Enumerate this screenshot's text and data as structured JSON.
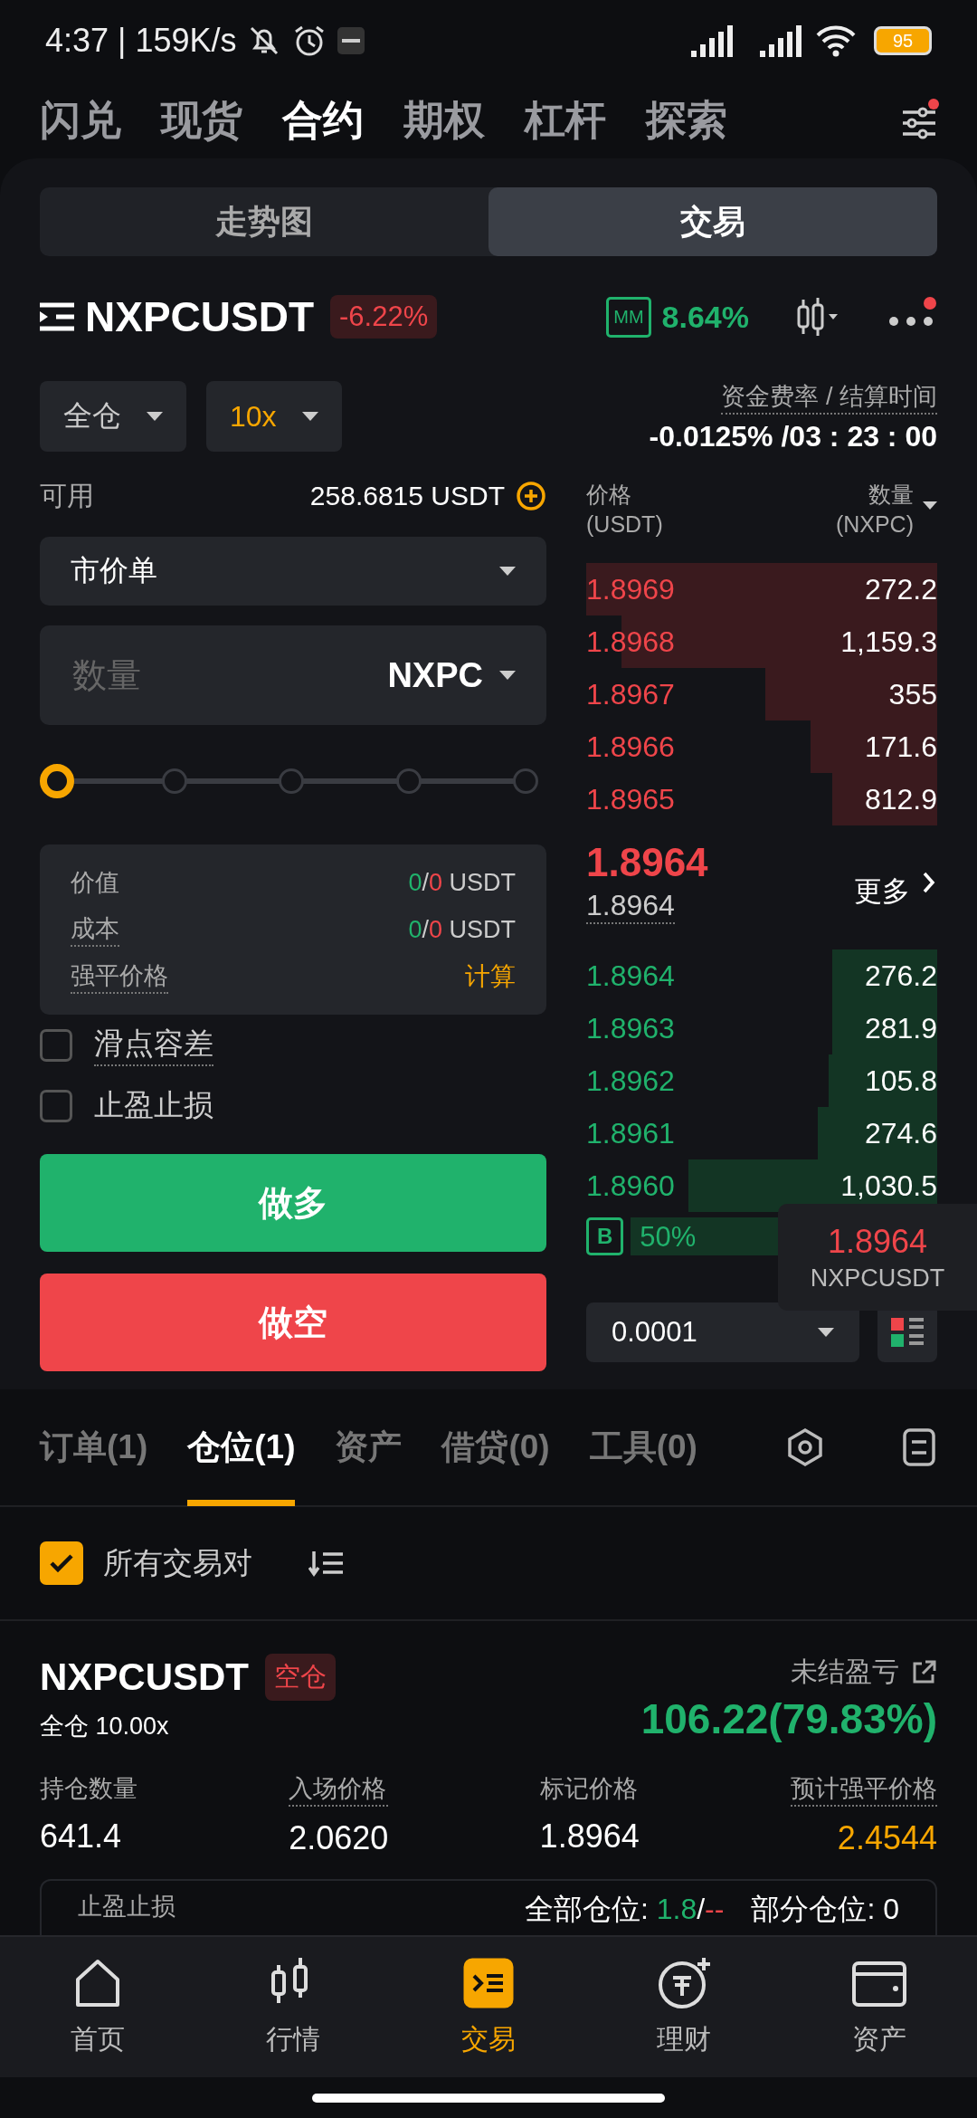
{
  "status_bar": {
    "text": "4:37 | 159K/s",
    "battery": "95"
  },
  "top_tabs": [
    {
      "label": "闪兑",
      "selected": false
    },
    {
      "label": "现货",
      "selected": false
    },
    {
      "label": "合约",
      "selected": true
    },
    {
      "label": "期权",
      "selected": false
    },
    {
      "label": "杠杆",
      "selected": false
    },
    {
      "label": "探索",
      "selected": false
    }
  ],
  "view_toggle": [
    {
      "label": "走势图",
      "selected": false
    },
    {
      "label": "交易",
      "selected": true
    }
  ],
  "symbol": {
    "name": "NXPCUSDT",
    "change": "-6.22%",
    "mm_label": "MM",
    "mm_rate": "8.64%"
  },
  "margin_mode": "全仓",
  "leverage": "10x",
  "funding": {
    "label": "资金费率 / 结算时间",
    "value": "-0.0125% /03 : 23 : 00"
  },
  "available": {
    "label": "可用",
    "value": "258.6815 USDT"
  },
  "order_type": "市价单",
  "quantity": {
    "placeholder": "数量",
    "unit": "NXPC"
  },
  "slider": {
    "level": 0
  },
  "summary": [
    {
      "kind": "values",
      "label": "价值",
      "underlined": false,
      "buy": "0",
      "sep": "/",
      "sell": "0",
      "unit": "USDT"
    },
    {
      "kind": "values",
      "label": "成本",
      "underlined": true,
      "buy": "0",
      "sep": "/",
      "sell": "0",
      "unit": "USDT"
    },
    {
      "kind": "action",
      "label": "强平价格",
      "underlined": true,
      "action": "计算"
    }
  ],
  "options": [
    {
      "label": "滑点容差",
      "underlined": true,
      "checked": false
    },
    {
      "label": "止盈止损",
      "underlined": false,
      "checked": false
    }
  ],
  "buttons": {
    "long": "做多",
    "short": "做空"
  },
  "orderbook": {
    "price_header": "价格",
    "price_unit": "(USDT)",
    "qty_header": "数量",
    "qty_unit": "(NXPC)",
    "asks": [
      {
        "price": "1.8969",
        "qty": "272.2"
      },
      {
        "price": "1.8968",
        "qty": "1,159.3"
      },
      {
        "price": "1.8967",
        "qty": "355"
      },
      {
        "price": "1.8966",
        "qty": "171.6"
      },
      {
        "price": "1.8965",
        "qty": "812.9"
      }
    ],
    "last_price": "1.8964",
    "mark_price": "1.8964",
    "more": "更多",
    "bids": [
      {
        "price": "1.8964",
        "qty": "276.2"
      },
      {
        "price": "1.8963",
        "qty": "281.9"
      },
      {
        "price": "1.8962",
        "qty": "105.8"
      },
      {
        "price": "1.8961",
        "qty": "274.6"
      },
      {
        "price": "1.8960",
        "qty": "1,030.5"
      }
    ],
    "buy_ratio": {
      "label": "B",
      "value": "50%",
      "level": 0.5
    },
    "tick": "0.0001"
  },
  "tooltip": {
    "price": "1.8964",
    "symbol": "NXPCUSDT"
  },
  "bottom_tabs": [
    {
      "label": "订单(1)",
      "selected": false
    },
    {
      "label": "仓位(1)",
      "selected": true
    },
    {
      "label": "资产",
      "selected": false
    },
    {
      "label": "借贷(0)",
      "selected": false
    },
    {
      "label": "工具(0)",
      "selected": false
    }
  ],
  "filter": {
    "label": "所有交易对",
    "checked": true
  },
  "position": {
    "symbol": "NXPCUSDT",
    "side": "空仓",
    "mode": "全仓 10.00x",
    "pnl_label": "未结盈亏",
    "pnl": "106.22(79.83%)",
    "stats": [
      {
        "label": "持仓数量",
        "value": "641.4",
        "underlined": false,
        "highlighted": false
      },
      {
        "label": "入场价格",
        "value": "2.0620",
        "underlined": true,
        "highlighted": false
      },
      {
        "label": "标记价格",
        "value": "1.8964",
        "underlined": false,
        "highlighted": false
      },
      {
        "label": "预计强平价格",
        "value": "2.4544",
        "underlined": true,
        "highlighted": true
      }
    ],
    "tpsl": {
      "label": "止盈止损",
      "all_label": "全部仓位:",
      "tp": "1.8",
      "sep": "/",
      "sl": "--",
      "partial": "部分仓位: 0"
    }
  },
  "nav": [
    {
      "label": "首页",
      "selected": false
    },
    {
      "label": "行情",
      "selected": false
    },
    {
      "label": "交易",
      "selected": true
    },
    {
      "label": "理财",
      "selected": false
    },
    {
      "label": "资产",
      "selected": false
    }
  ]
}
